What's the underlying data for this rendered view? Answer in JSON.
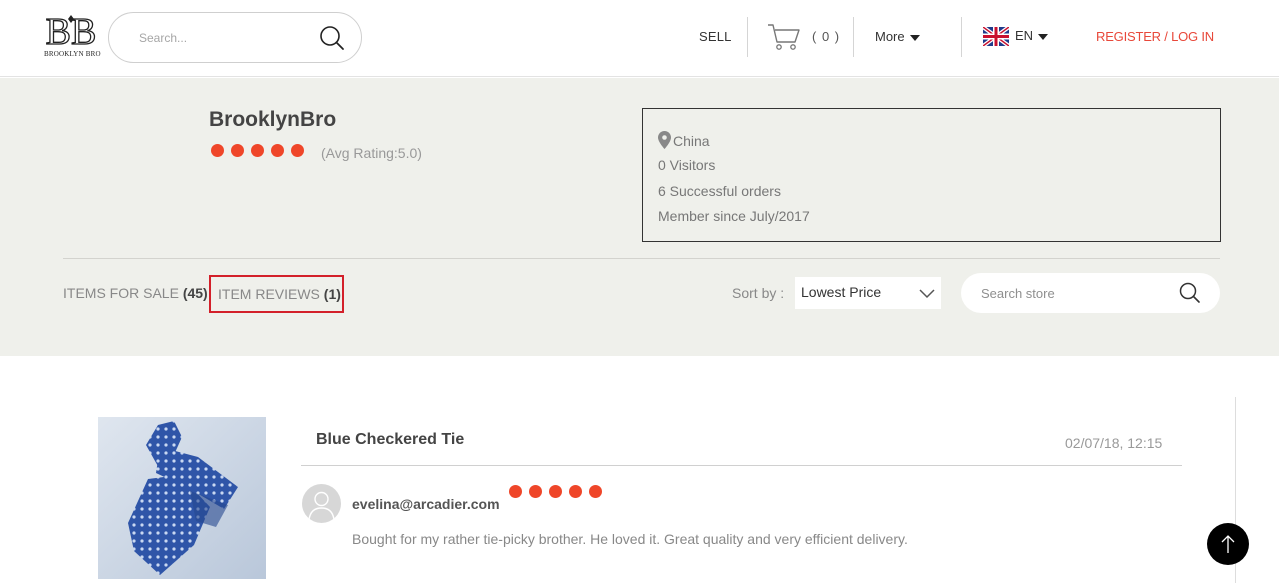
{
  "header": {
    "logo_text": "BROOKLYN BRO",
    "search_placeholder": "Search...",
    "sell_label": "SELL",
    "cart_count": "( 0 )",
    "more_label": "More",
    "lang_label": "EN",
    "register_label": "REGISTER / LOG IN",
    "accent_color": "#e8483a"
  },
  "store": {
    "name": "BrooklynBro",
    "rating_stars": 5,
    "avg_rating_text": "(Avg Rating:5.0)",
    "location": "China",
    "visitors": "0 Visitors",
    "orders": "6 Successful orders",
    "member_since": "Member since July/2017"
  },
  "tabs": {
    "items_label": "ITEMS FOR SALE",
    "items_count": "(45)",
    "reviews_label": "ITEM REVIEWS",
    "reviews_count": "(1)"
  },
  "sort": {
    "label": "Sort by :",
    "selected": "Lowest Price"
  },
  "store_search": {
    "placeholder": "Search store"
  },
  "review": {
    "product_title": "Blue Checkered Tie",
    "date": "02/07/18, 12:15",
    "reviewer": "evelina@arcadier.com",
    "stars": 5,
    "text": "Bought for my rather tie-picky brother. He loved it. Great quality and very efficient delivery."
  },
  "icons": {
    "search": "search-icon",
    "cart": "cart-icon",
    "flag": "uk-flag-icon",
    "location": "location-pin-icon",
    "chevron": "chevron-down-icon",
    "avatar": "user-avatar-icon",
    "back_to_top": "arrow-up-icon"
  }
}
